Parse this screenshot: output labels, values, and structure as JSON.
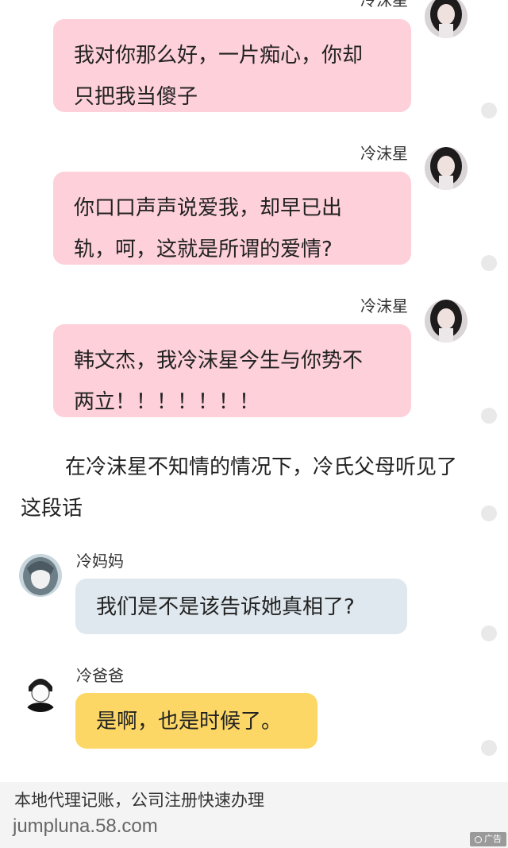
{
  "messages": [
    {
      "sender": "冷沫星",
      "lines": [
        "我对你那么好，一片痴心，你却",
        "只把我当傻子"
      ]
    },
    {
      "sender": "冷沫星",
      "lines": [
        "你口口声声说爱我，却早已出",
        "轨，呵，这就是所谓的爱情?"
      ]
    },
    {
      "sender": "冷沫星",
      "lines": [
        "韩文杰，我冷沫星今生与你势不",
        "两立！！！！！！！"
      ]
    },
    {
      "sender": "冷妈妈",
      "lines": [
        "我们是不是该告诉她真相了?"
      ]
    },
    {
      "sender": "冷爸爸",
      "lines": [
        "是啊，也是时候了。"
      ]
    }
  ],
  "narration": "在冷沫星不知情的情况下，冷氏父母听见了这段话",
  "ad": {
    "title": "本地代理记账，公司注册快速办理",
    "url": "jumpluna.58.com",
    "badge": "广告"
  },
  "colors": {
    "pink_bubble": "#fdd0da",
    "blue_bubble": "#dfe8ee",
    "yellow_bubble": "#fcd766",
    "dot": "#e9e9e9"
  },
  "icons": [
    "girl-avatar-icon",
    "mother-avatar-icon",
    "father-avatar-icon"
  ]
}
